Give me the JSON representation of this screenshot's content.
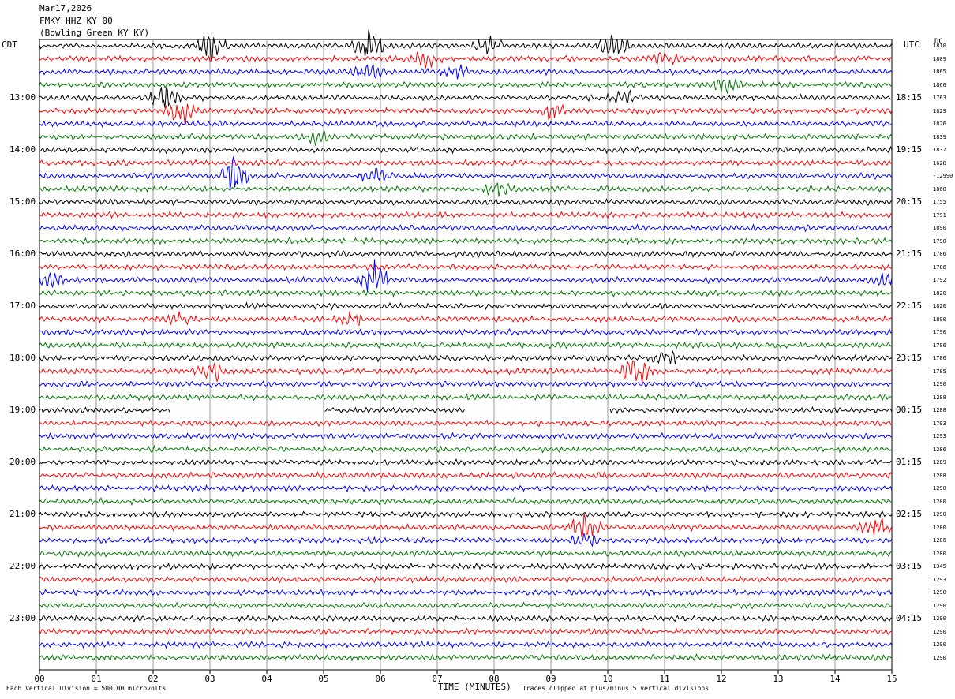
{
  "header": {
    "date": "Mar17,2026",
    "station": "FMKY HHZ KY 00",
    "location": "(Bowling Green KY KY)"
  },
  "left_tz": "CDT",
  "right_tz": "UTC",
  "dc_label": "DC",
  "chart_data": {
    "type": "line",
    "title": "FMKY HHZ KY 00 helicorder",
    "xlabel": "TIME (MINUTES)",
    "xlim": [
      0,
      15
    ],
    "x_ticks": [
      "00",
      "01",
      "02",
      "03",
      "04",
      "05",
      "06",
      "07",
      "08",
      "09",
      "10",
      "11",
      "12",
      "13",
      "14",
      "15"
    ],
    "row_count": 48,
    "row_minutes": 15,
    "trace_colors": [
      "#000000",
      "#ff0000",
      "#0000ff",
      "#007a00"
    ],
    "left_time_labels": [
      "13:00",
      "14:00",
      "15:00",
      "16:00",
      "17:00",
      "18:00",
      "19:00",
      "20:00",
      "21:00",
      "22:00",
      "23:00"
    ],
    "right_time_labels": [
      "18:15",
      "19:15",
      "20:15",
      "21:15",
      "22:15",
      "23:15",
      "00:15",
      "01:15",
      "02:15",
      "03:15",
      "04:15"
    ],
    "dc_offsets": [
      "1810",
      "1809",
      "1865",
      "1866",
      "1763",
      "1829",
      "1826",
      "1839",
      "1837",
      "1628",
      "-12990",
      "1868",
      "1755",
      "1791",
      "1890",
      "1790",
      "1786",
      "1786",
      "1792",
      "1820",
      "1820",
      "1890",
      "1790",
      "1786",
      "1786",
      "1785",
      "1290",
      "1288",
      "1288",
      "1793",
      "1293",
      "1286",
      "1289",
      "1288",
      "1290",
      "1280",
      "1290",
      "1280",
      "1286",
      "1280",
      "1345",
      "1293",
      "1290",
      "1290",
      "1290",
      "1290",
      "1290",
      "1290"
    ],
    "events": [
      {
        "row": 0,
        "minute": 3.0,
        "amp": 4
      },
      {
        "row": 0,
        "minute": 5.8,
        "amp": 5
      },
      {
        "row": 0,
        "minute": 7.9,
        "amp": 3
      },
      {
        "row": 0,
        "minute": 10.1,
        "amp": 4
      },
      {
        "row": 1,
        "minute": 6.8,
        "amp": 2
      },
      {
        "row": 1,
        "minute": 11.0,
        "amp": 2
      },
      {
        "row": 2,
        "minute": 5.8,
        "amp": 2
      },
      {
        "row": 2,
        "minute": 7.3,
        "amp": 2
      },
      {
        "row": 3,
        "minute": 12.1,
        "amp": 2
      },
      {
        "row": 4,
        "minute": 2.2,
        "amp": 3
      },
      {
        "row": 4,
        "minute": 10.3,
        "amp": 2
      },
      {
        "row": 5,
        "minute": 2.5,
        "amp": 4
      },
      {
        "row": 5,
        "minute": 9.0,
        "amp": 2
      },
      {
        "row": 7,
        "minute": 4.9,
        "amp": 2
      },
      {
        "row": 10,
        "minute": 3.4,
        "amp": 5
      },
      {
        "row": 10,
        "minute": 5.9,
        "amp": 2
      },
      {
        "row": 11,
        "minute": 8.1,
        "amp": 2
      },
      {
        "row": 18,
        "minute": 5.9,
        "amp": 5
      },
      {
        "row": 18,
        "minute": 0.2,
        "amp": 2
      },
      {
        "row": 18,
        "minute": 14.9,
        "amp": 2
      },
      {
        "row": 21,
        "minute": 2.5,
        "amp": 2
      },
      {
        "row": 21,
        "minute": 5.5,
        "amp": 2
      },
      {
        "row": 24,
        "minute": 11.0,
        "amp": 2
      },
      {
        "row": 25,
        "minute": 3.0,
        "amp": 3
      },
      {
        "row": 25,
        "minute": 10.5,
        "amp": 4
      },
      {
        "row": 37,
        "minute": 9.6,
        "amp": 4
      },
      {
        "row": 37,
        "minute": 14.7,
        "amp": 3
      },
      {
        "row": 38,
        "minute": 9.6,
        "amp": 2
      }
    ],
    "gaps": [
      {
        "row": 28,
        "from": 2.3,
        "to": 5.0
      },
      {
        "row": 28,
        "from": 7.5,
        "to": 10.0
      }
    ]
  },
  "footer": {
    "scale_note": "Each Vertical Division =  500.00 microvolts",
    "clip_note": "Traces clipped at plus/minus 5 vertical divisions"
  }
}
